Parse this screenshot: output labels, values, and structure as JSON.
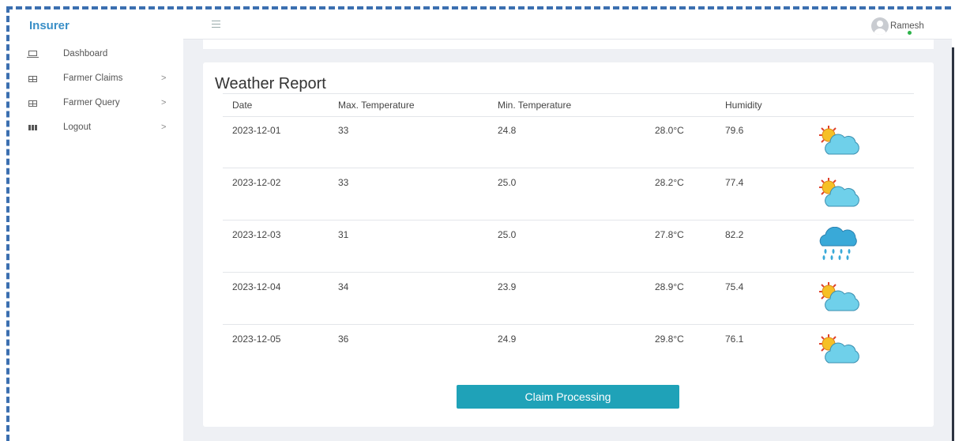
{
  "brand": "Insurer",
  "user": {
    "name": "Ramesh"
  },
  "sidebar": {
    "items": [
      {
        "label": "Dashboard",
        "icon": "laptop-icon",
        "chevron": ""
      },
      {
        "label": "Farmer Claims",
        "icon": "table-icon",
        "chevron": ">"
      },
      {
        "label": "Farmer Query",
        "icon": "table-icon",
        "chevron": ">"
      },
      {
        "label": "Logout",
        "icon": "grid-icon",
        "chevron": ">"
      }
    ]
  },
  "report": {
    "title": "Weather Report",
    "headers": {
      "date": "Date",
      "max": "Max. Temperature",
      "min": "Min. Temperature",
      "humidity": "Humidity"
    },
    "rows": [
      {
        "date": "2023-12-01",
        "max": "33",
        "min": "24.8",
        "avg": "28.0°C",
        "humidity": "79.6",
        "icon": "partly-cloudy-icon"
      },
      {
        "date": "2023-12-02",
        "max": "33",
        "min": "25.0",
        "avg": "28.2°C",
        "humidity": "77.4",
        "icon": "partly-cloudy-icon"
      },
      {
        "date": "2023-12-03",
        "max": "31",
        "min": "25.0",
        "avg": "27.8°C",
        "humidity": "82.2",
        "icon": "rain-icon"
      },
      {
        "date": "2023-12-04",
        "max": "34",
        "min": "23.9",
        "avg": "28.9°C",
        "humidity": "75.4",
        "icon": "partly-cloudy-icon"
      },
      {
        "date": "2023-12-05",
        "max": "36",
        "min": "24.9",
        "avg": "29.8°C",
        "humidity": "76.1",
        "icon": "partly-cloudy-icon"
      }
    ],
    "button": "Claim Processing"
  },
  "colors": {
    "accent": "#1fa2b8",
    "brand": "#3a8fc7",
    "border": "#3b6fb0"
  }
}
